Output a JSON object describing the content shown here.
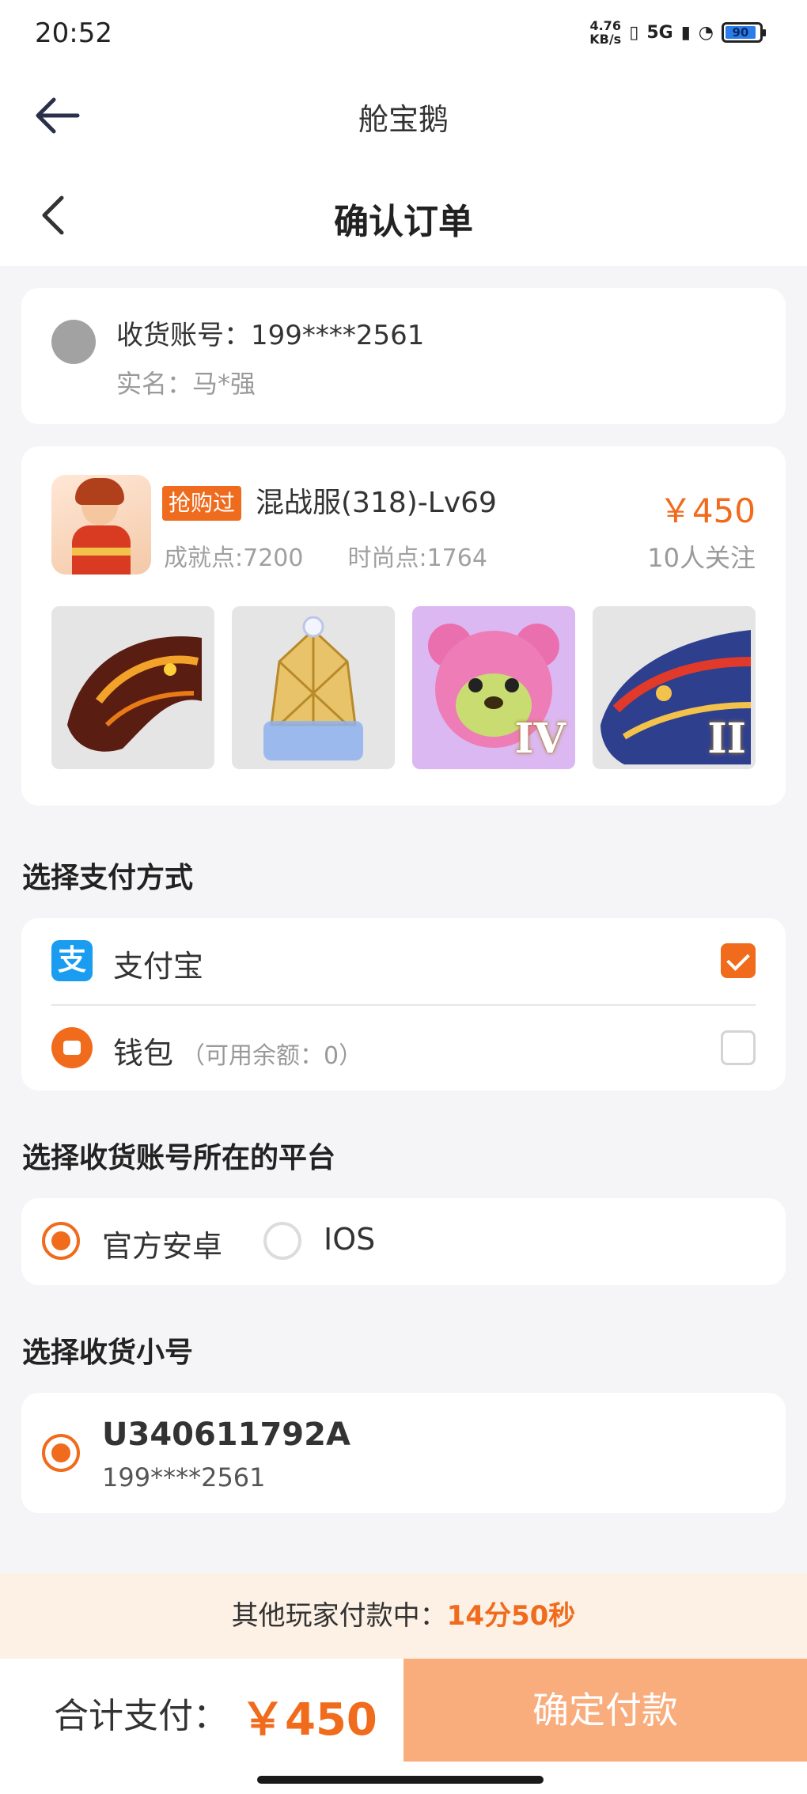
{
  "status_bar": {
    "time": "20:52",
    "net_speed_top": "4.76",
    "net_speed_bottom": "KB/s",
    "signal_label": "5G",
    "battery": "90"
  },
  "app_header": {
    "title": "舱宝鹅"
  },
  "page_header": {
    "title": "确认订单"
  },
  "account": {
    "line": "收货账号：199****2561",
    "realname": "实名：马*强"
  },
  "product": {
    "tag": "抢购过",
    "name": "混战服(318)-Lv69",
    "price": "￥450",
    "achievement": "成就点:7200",
    "fashion": "时尚点:1764",
    "followers": "10人关注",
    "thumbnails": [
      {
        "icon": "dragon-head-icon",
        "badge": ""
      },
      {
        "icon": "crystal-crown-icon",
        "badge": ""
      },
      {
        "icon": "pink-bear-icon",
        "badge": "IV"
      },
      {
        "icon": "blue-dragon-icon",
        "badge": "II"
      }
    ]
  },
  "payment": {
    "section_title": "选择支付方式",
    "alipay_label": "支付宝",
    "alipay_icon_glyph": "支",
    "wallet_label": "钱包",
    "wallet_note": "（可用余额：0）",
    "selected": "alipay",
    "accent": "#f06b1c"
  },
  "platform": {
    "section_title": "选择收货账号所在的平台",
    "options": [
      "官方安卓",
      "IOS"
    ],
    "selected": "官方安卓"
  },
  "alt_account": {
    "section_title": "选择收货小号",
    "id": "U340611792A",
    "phone": "199****2561"
  },
  "notice": {
    "text": "其他玩家付款中：",
    "time": "14分50秒"
  },
  "footer": {
    "total_label": "合计支付：",
    "total_amount": "￥450",
    "confirm_label": "确定付款"
  }
}
